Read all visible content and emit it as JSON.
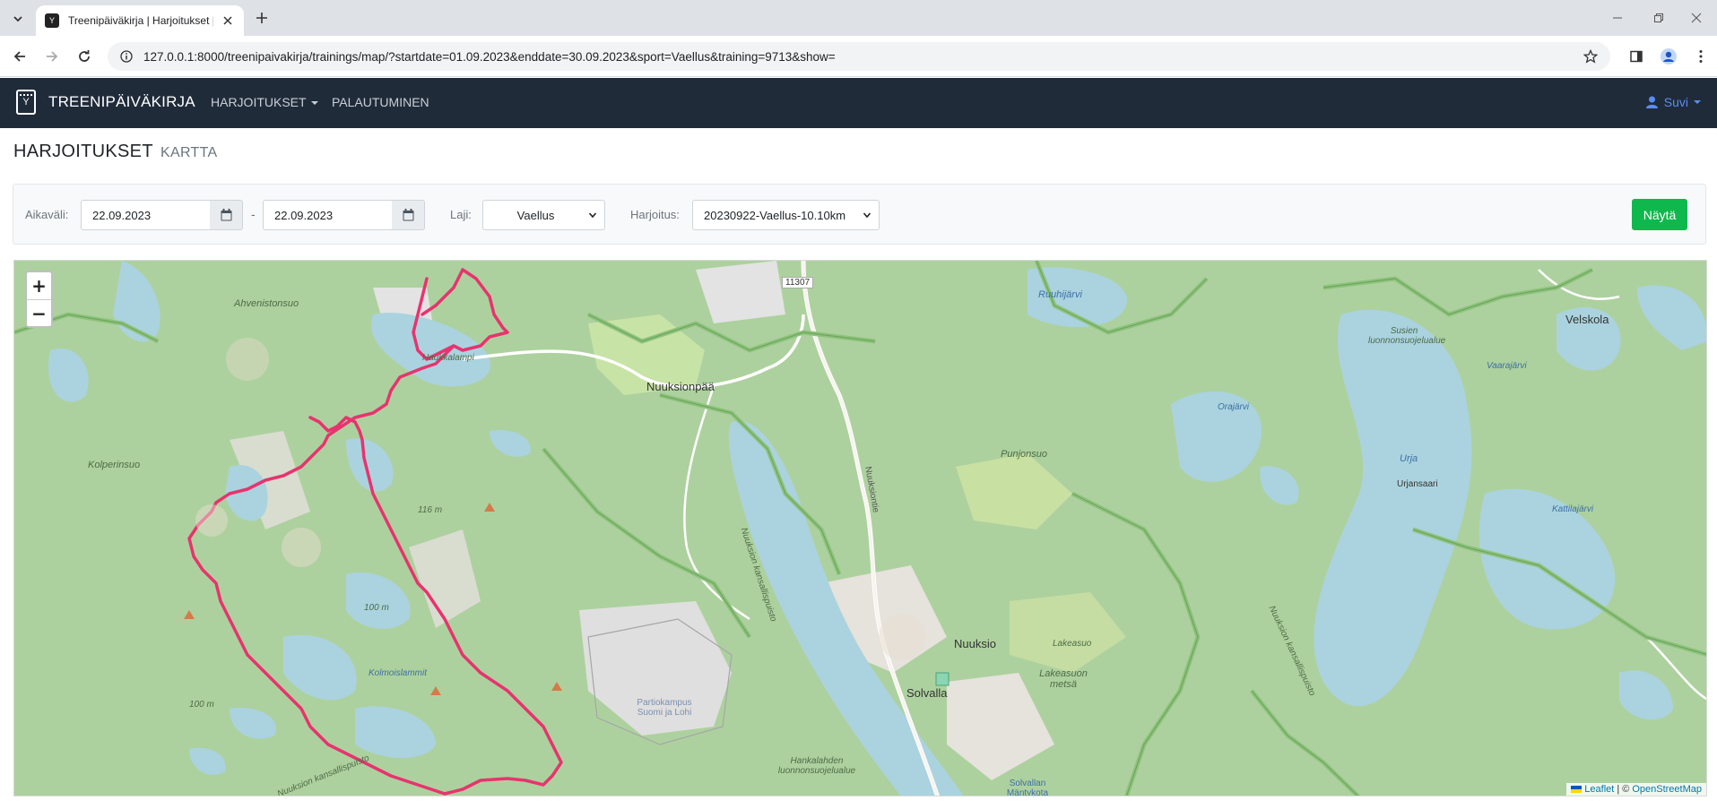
{
  "browser": {
    "tab_title": "Treenipäiväkirja | Harjoitukset |",
    "url": "127.0.0.1:8000/treenipaivakirja/trainings/map/?startdate=01.09.2023&enddate=30.09.2023&sport=Vaellus&training=9713&show="
  },
  "navbar": {
    "brand": "TREENIPÄIVÄKIRJA",
    "items": [
      {
        "label": "HARJOITUKSET",
        "dropdown": true
      },
      {
        "label": "PALAUTUMINEN",
        "dropdown": false
      }
    ],
    "user": "Suvi"
  },
  "page": {
    "title": "HARJOITUKSET",
    "subtitle": "KARTTA"
  },
  "filters": {
    "range_label": "Aikaväli:",
    "start_date": "22.09.2023",
    "separator": "-",
    "end_date": "22.09.2023",
    "sport_label": "Laji:",
    "sport_value": "Vaellus",
    "training_label": "Harjoitus:",
    "training_value": "20230922-Vaellus-10.10km",
    "show_button": "Näytä"
  },
  "map": {
    "zoom_in": "+",
    "zoom_out": "−",
    "attribution_leaflet": "Leaflet",
    "attribution_sep": "| ©",
    "attribution_osm": "OpenStreetMap",
    "route_color": "#e8336f",
    "labels": {
      "ahvenistonsuo": "Ahvenistonsuo",
      "haukkalampi": "Haukkalampi",
      "road_11307": "11307",
      "nuuksionpaa": "Nuuksionpää",
      "ruuhijarvi": "Ruuhijärvi",
      "susien": "Susien luonnonsuojelualue",
      "velskola": "Velskola",
      "vaarajarvi": "Vaarajärvi",
      "orajarvi": "Orajärvi",
      "kolperinsuo": "Kolperinsuo",
      "elev_116": "116 m",
      "nuuksiontie": "Nuuksiontie",
      "punjonsuo": "Punjonsuo",
      "urja": "Urja",
      "urjansaari": "Urjansaari",
      "kattilajarvi": "Kattilajärvi",
      "nuuksio_np": "Nuuksion kansallispuisto",
      "elev_100_a": "100 m",
      "kolmoislammit": "Kolmoislammit",
      "partiokampus": "Partiokampus Suomi ja Lohi",
      "nuuksio": "Nuuksio",
      "lakeasuo": "Lakeasuo",
      "lakeasuon_metsa": "Lakeasuon metsä",
      "solvalla": "Solvalla",
      "elev_100_b": "100 m",
      "hankalahden": "Hankalahden luonnonsuojelualue",
      "solvallan": "Solvallan Mäntykota",
      "nuuksion_kp_right": "Nuuksion kansallispuisto",
      "nuuksion_kp_bottom": "Nuuksion kansallispuisto"
    }
  }
}
